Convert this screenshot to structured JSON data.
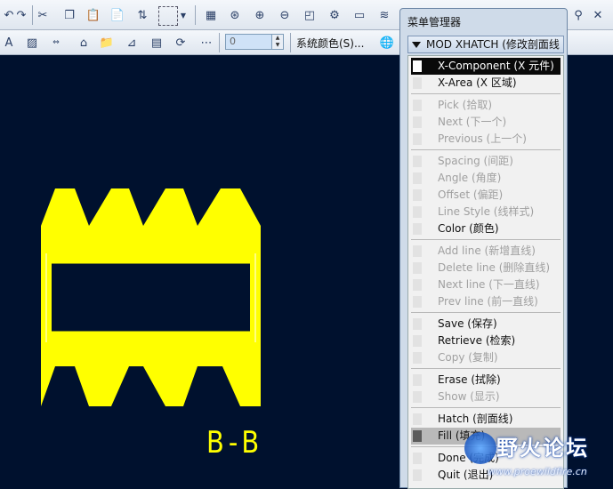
{
  "toolbar": {
    "spin_value": "0",
    "system_color_label": "系统颜色(S)..."
  },
  "menu_manager": {
    "title": "菜单管理器",
    "header": "MOD XHATCH (修改剖面线",
    "items": [
      {
        "label": "X-Component (X 元件)",
        "state": "selected"
      },
      {
        "label": "X-Area (X 区域)",
        "state": "enabled"
      },
      {
        "label": "Pick (拾取)",
        "state": "disabled"
      },
      {
        "label": "Next (下一个)",
        "state": "disabled"
      },
      {
        "label": "Previous (上一个)",
        "state": "disabled"
      },
      {
        "label": "Spacing (间距)",
        "state": "disabled"
      },
      {
        "label": "Angle (角度)",
        "state": "disabled"
      },
      {
        "label": "Offset (偏距)",
        "state": "disabled"
      },
      {
        "label": "Line Style (线样式)",
        "state": "disabled"
      },
      {
        "label": "Color (颜色)",
        "state": "enabled"
      },
      {
        "label": "Add line (新增直线)",
        "state": "disabled"
      },
      {
        "label": "Delete line (删除直线)",
        "state": "disabled"
      },
      {
        "label": "Next line (下一直线)",
        "state": "disabled"
      },
      {
        "label": "Prev line (前一直线)",
        "state": "disabled"
      },
      {
        "label": "Save (保存)",
        "state": "enabled"
      },
      {
        "label": "Retrieve (检索)",
        "state": "enabled"
      },
      {
        "label": "Copy (复制)",
        "state": "disabled"
      },
      {
        "label": "Erase (拭除)",
        "state": "enabled"
      },
      {
        "label": "Show (显示)",
        "state": "disabled"
      },
      {
        "label": "Hatch (剖面线)",
        "state": "enabled"
      },
      {
        "label": "Fill (填充)",
        "state": "checked"
      },
      {
        "label": "Done (完成)",
        "state": "enabled"
      },
      {
        "label": "Quit (退出)",
        "state": "enabled"
      }
    ]
  },
  "drawing": {
    "section_label": "B-B",
    "fill_color": "#ffff00",
    "background_color": "#00112e"
  },
  "watermark": {
    "text": "野火论坛",
    "url": "www.proewildfire.cn"
  },
  "colors": {
    "menu_selected_bg": "#0a0a0a",
    "disabled_text": "#a0a0a0"
  }
}
